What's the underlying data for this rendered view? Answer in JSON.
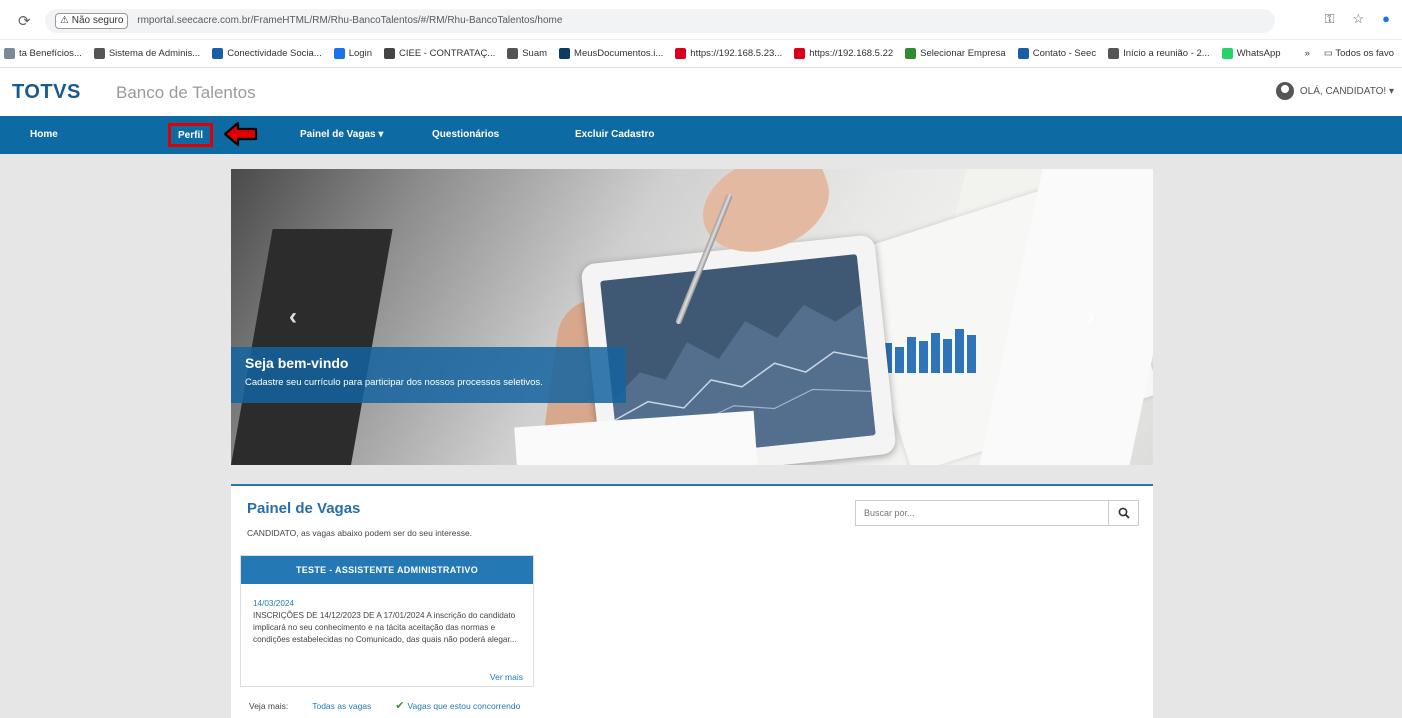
{
  "browser": {
    "security_label": "Não seguro",
    "url": "rmportal.seecacre.com.br/FrameHTML/RM/Rhu-BancoTalentos/#/RM/Rhu-BancoTalentos/home",
    "bookmarks": [
      {
        "label": "ta Benefícios...",
        "color": "#7a8a99"
      },
      {
        "label": "Sistema de Adminis...",
        "color": "#555555"
      },
      {
        "label": "Conectividade Socia...",
        "color": "#1b5ea8"
      },
      {
        "label": "Login",
        "color": "#1a73e8"
      },
      {
        "label": "CIEE - CONTRATAÇ...",
        "color": "#444444"
      },
      {
        "label": "Suam",
        "color": "#555555"
      },
      {
        "label": "MeusDocumentos.i...",
        "color": "#0d3b66"
      },
      {
        "label": "https://192.168.5.23...",
        "color": "#d9001b"
      },
      {
        "label": "https://192.168.5.22",
        "color": "#d9001b"
      },
      {
        "label": "Selecionar Empresa",
        "color": "#2e8b2e"
      },
      {
        "label": "Contato - Seec",
        "color": "#1b5ea8"
      },
      {
        "label": "Início a reunião - 2...",
        "color": "#555555"
      },
      {
        "label": "WhatsApp",
        "color": "#25d366"
      }
    ],
    "all_bookmarks": "Todos os favo"
  },
  "header": {
    "logo": "TOTVS",
    "title": "Banco de Talentos",
    "user": "OLÁ, CANDIDATO! ▾"
  },
  "nav": {
    "home": "Home",
    "perfil": "Perfil",
    "painel": "Painel de Vagas ▾",
    "questionarios": "Questionários",
    "excluir": "Excluir Cadastro"
  },
  "carousel": {
    "heading": "Seja bem-vindo",
    "text": "Cadastre seu currículo para participar dos nossos processos seletivos."
  },
  "panel": {
    "title": "Painel de Vagas",
    "subtitle": "CANDIDATO, as vagas abaixo podem ser do seu interesse.",
    "search_placeholder": "Buscar por...",
    "card": {
      "title": "TESTE - ASSISTENTE ADMINISTRATIVO",
      "date": "14/03/2024",
      "description": "INSCRIÇÕES DE 14/12/2023 DE A 17/01/2024 A inscrição do candidato implicará no seu conhecimento e na tácita aceitação das normas e condições estabelecidas no Comunicado, das quais não poderá alegar...",
      "more": "Ver mais"
    },
    "footer": {
      "label": "Veja mais:",
      "all": "Todas as vagas",
      "applied": "Vagas que estou concorrendo"
    }
  },
  "colors": {
    "nav": "#0e6aa3",
    "accent": "#2479b5",
    "highlight": "#e00000"
  }
}
